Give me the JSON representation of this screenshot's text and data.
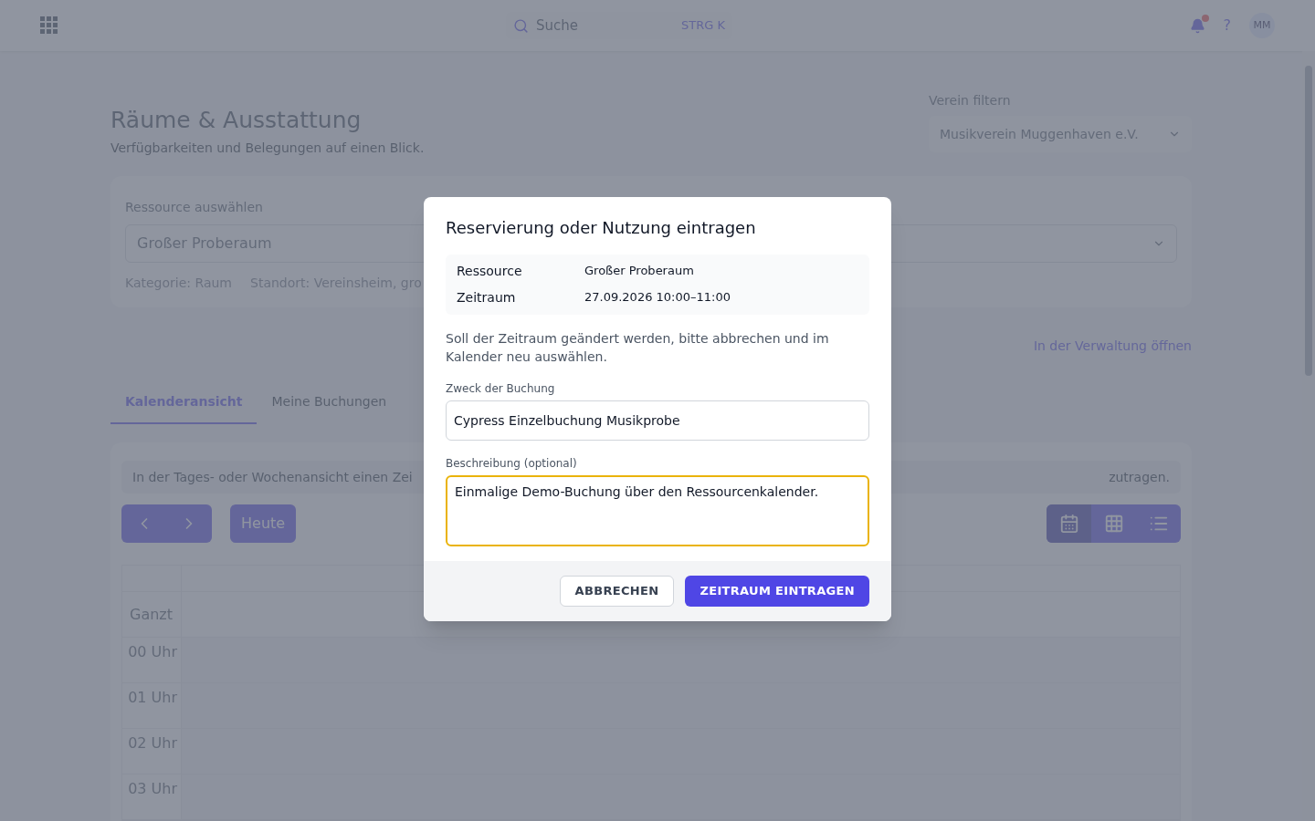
{
  "header": {
    "search": {
      "placeholder": "Suche",
      "shortcut": "STRG K"
    },
    "notification_dot": true,
    "help": "?",
    "avatar": "MM"
  },
  "page": {
    "title": "Räume & Ausstattung",
    "subtitle": "Verfügbarkeiten und Belegungen auf einen Blick.",
    "filter": {
      "label": "Verein filtern",
      "value": "Musikverein Muggenhaven e.V."
    }
  },
  "resource_card": {
    "label": "Ressource auswählen",
    "value": "Großer Proberaum",
    "meta": [
      "Kategorie: Raum",
      "Standort: Vereinsheim, gro"
    ]
  },
  "admin_link": "In der Verwaltung öffnen",
  "tabs": [
    {
      "label": "Kalenderansicht",
      "selected": true
    },
    {
      "label": "Meine Buchungen",
      "selected": false
    }
  ],
  "calendar": {
    "hint_left": "In der Tages- oder Wochenansicht einen Zei",
    "hint_right": "zutragen.",
    "today": "Heute",
    "views": [
      {
        "kind": "calendar",
        "selected": true
      },
      {
        "kind": "grid",
        "selected": false
      },
      {
        "kind": "list",
        "selected": false
      }
    ],
    "all_day": "Ganzt",
    "hours": [
      "00 Uhr",
      "01 Uhr",
      "02 Uhr",
      "03 Uhr"
    ]
  },
  "dialog": {
    "title": "Reservierung oder Nutzung eintragen",
    "summary": [
      {
        "label": "Ressource",
        "value": "Großer Proberaum"
      },
      {
        "label": "Zeitraum",
        "value": "27.09.2026 10:00–11:00"
      }
    ],
    "note": "Soll der Zeitraum geändert werden, bitte abbrechen und im Kalender neu auswählen.",
    "fields": [
      {
        "kind": "input",
        "label": "Zweck der Buchung",
        "value": "Cypress Einzelbuchung Musikprobe",
        "focused": false
      },
      {
        "kind": "textarea",
        "label": "Beschreibung (optional)",
        "value": "Einmalige Demo-Buchung über den Ressourcenkalender.",
        "focused": true
      }
    ],
    "buttons": [
      {
        "label": "ABBRECHEN",
        "kind": "secondary"
      },
      {
        "label": "ZEITRAUM EINTRAGEN",
        "kind": "primary"
      }
    ]
  }
}
